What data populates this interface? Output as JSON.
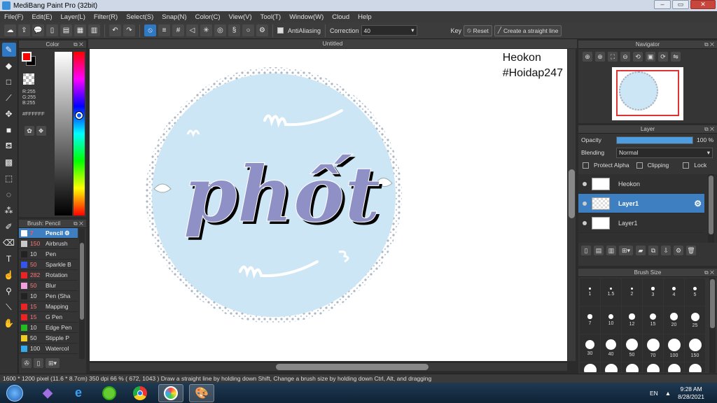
{
  "window": {
    "title": "MediBang Paint Pro (32bit)",
    "minimize": "–",
    "maximize": "▭",
    "close": "✕"
  },
  "menu": [
    "File(F)",
    "Edit(E)",
    "Layer(L)",
    "Filter(R)",
    "Select(S)",
    "Snap(N)",
    "Color(C)",
    "View(V)",
    "Tool(T)",
    "Window(W)",
    "Cloud",
    "Help"
  ],
  "toolbar": {
    "antialiasing_label": "AntiAliasing",
    "correction_label": "Correction",
    "correction_value": "40",
    "key_label": "Key",
    "reset_label": "Reset",
    "straight_line_label": "Create a straight line"
  },
  "color_panel": {
    "title": "Color",
    "r": "R:255",
    "g": "G:255",
    "b": "B:255",
    "hex": "#FFFFFF",
    "fg_color": "#ff0000",
    "bg_color": "#000000"
  },
  "brush_panel": {
    "title": "Brush: Pencil",
    "brushes": [
      {
        "size": "7",
        "name": "Pencil",
        "color": "#ffffff"
      },
      {
        "size": "150",
        "name": "Airbrush",
        "color": "#c8c8c8"
      },
      {
        "size": "10",
        "name": "Pen",
        "color": "#222222"
      },
      {
        "size": "50",
        "name": "Sparkle B",
        "color": "#3355ee"
      },
      {
        "size": "282",
        "name": "Rotation",
        "color": "#ee2222"
      },
      {
        "size": "50",
        "name": "Blur",
        "color": "#f0a0e0"
      },
      {
        "size": "10",
        "name": "Pen (Sha",
        "color": "#222222"
      },
      {
        "size": "15",
        "name": "Mapping",
        "color": "#ee2222"
      },
      {
        "size": "15",
        "name": "G Pen",
        "color": "#ee2222"
      },
      {
        "size": "10",
        "name": "Edge Pen",
        "color": "#22bb22"
      },
      {
        "size": "50",
        "name": "Stipple P",
        "color": "#eecc22"
      },
      {
        "size": "100",
        "name": "Watercol",
        "color": "#33aaee"
      }
    ]
  },
  "document": {
    "tab_title": "Untitled",
    "watermark_line1": "Heokon",
    "watermark_line2": "#Hoidap247",
    "lettering": "phốt"
  },
  "navigator": {
    "title": "Navigator"
  },
  "layer_panel": {
    "title": "Layer",
    "opacity_label": "Opacity",
    "opacity_value": "100 %",
    "opacity": 1.0,
    "blending_label": "Blending",
    "blending_value": "Normal",
    "protect_alpha": "Protect Alpha",
    "clipping": "Clipping",
    "lock": "Lock",
    "layers": [
      {
        "name": "Heokon"
      },
      {
        "name": "Layer1"
      },
      {
        "name": "Layer1"
      }
    ]
  },
  "brush_size_panel": {
    "title": "Brush Size",
    "sizes": [
      "1",
      "1.5",
      "2",
      "3",
      "4",
      "5",
      "7",
      "10",
      "12",
      "15",
      "20",
      "25",
      "30",
      "40",
      "50",
      "70",
      "100",
      "150"
    ]
  },
  "status": {
    "text": "1600 * 1200 pixel   (11.6 * 8.7cm)   350 dpi   66 %   ( 672, 1043 )   Draw a straight line by holding down Shift, Change a brush size by holding down Ctrl, Alt, and dragging"
  },
  "taskbar": {
    "lang": "EN",
    "time": "9:28 AM",
    "date": "8/28/2021"
  }
}
